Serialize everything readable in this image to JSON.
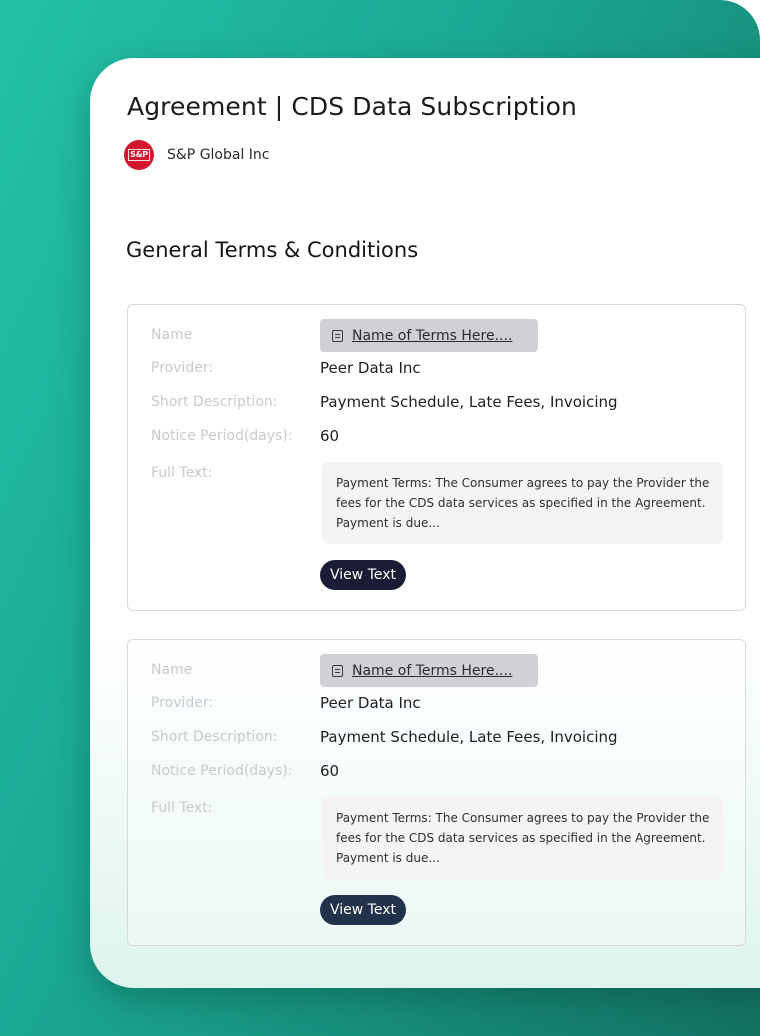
{
  "agreement": {
    "title": "Agreement | CDS Data Subscription",
    "company": {
      "logo_text": "S&P",
      "name": "S&P Global Inc"
    }
  },
  "section": {
    "title": "General Terms & Conditions"
  },
  "labels": {
    "name": "Name",
    "provider": "Provider:",
    "short_description": "Short Description:",
    "notice_period": "Notice Period(days):",
    "full_text": "Full Text:"
  },
  "terms": [
    {
      "name_link": "Name of Terms Here....",
      "provider": "Peer Data Inc",
      "short_description": "Payment Schedule, Late Fees, Invoicing",
      "notice_period": "60",
      "full_text": "Payment Terms: The Consumer agrees to pay the Provider the fees for the CDS data services as  specified in the Agreement. Payment is due...",
      "button_label": "View Text"
    },
    {
      "name_link": "Name of Terms Here....",
      "provider": "Peer Data Inc",
      "short_description": "Payment Schedule, Late Fees, Invoicing",
      "notice_period": "60",
      "full_text": "Payment Terms: The Consumer agrees to pay the Provider the fees for the CDS data services as  specified in the Agreement. Payment is due...",
      "button_label": "View Text"
    }
  ],
  "colors": {
    "brand_red": "#d3172f",
    "button_navy": "#1a1c35",
    "background_teal": "#1aa893"
  }
}
